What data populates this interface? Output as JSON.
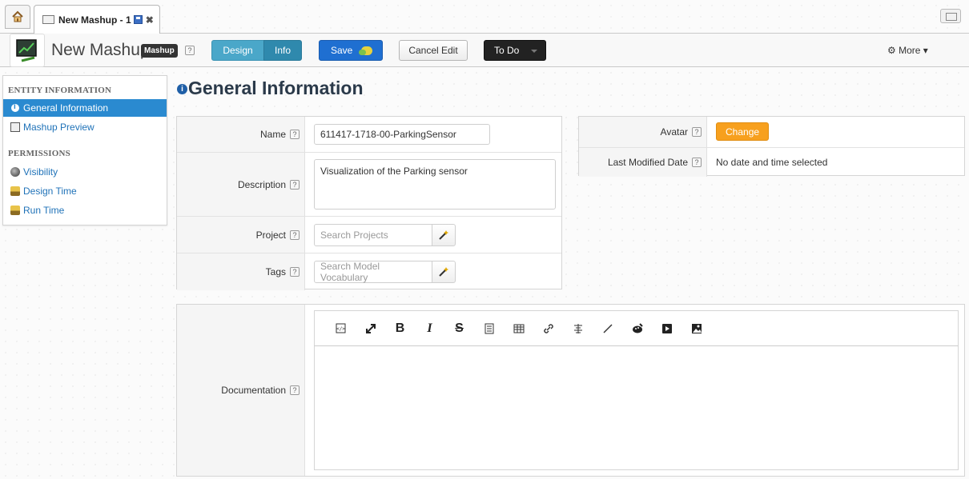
{
  "tabs": {
    "home_icon": "home-icon",
    "active_tab_label": "New Mashup - 1"
  },
  "toolbar": {
    "entity_name": "New Mashup",
    "entity_type_badge": "Mashup",
    "help_glyph": "?",
    "design_label": "Design",
    "info_label": "Info",
    "save_label": "Save",
    "cancel_label": "Cancel Edit",
    "todo_label": "To Do",
    "more_label": "More"
  },
  "sidebar": {
    "section1_title": "ENTITY INFORMATION",
    "items1": [
      {
        "label": "General Information",
        "active": true
      },
      {
        "label": "Mashup Preview",
        "active": false
      }
    ],
    "section2_title": "PERMISSIONS",
    "items2": [
      {
        "label": "Visibility"
      },
      {
        "label": "Design Time"
      },
      {
        "label": "Run Time"
      }
    ]
  },
  "main": {
    "title": "General Information",
    "fields": {
      "name_label": "Name",
      "name_value": "611417-1718-00-ParkingSensor",
      "description_label": "Description",
      "description_value": "Visualization of the Parking sensor",
      "project_label": "Project",
      "project_placeholder": "Search Projects",
      "tags_label": "Tags",
      "tags_placeholder": "Search Model Vocabulary",
      "avatar_label": "Avatar",
      "change_label": "Change",
      "modified_label": "Last Modified Date",
      "modified_value": "No date and time selected",
      "documentation_label": "Documentation"
    },
    "doc_tools": [
      "source-icon",
      "fullscreen-icon",
      "bold-icon",
      "italic-icon",
      "strikethrough-icon",
      "list-icon",
      "table-icon",
      "link-icon",
      "align-icon",
      "line-icon",
      "color-icon",
      "video-icon",
      "image-icon"
    ]
  },
  "colors": {
    "accent": "#2a8ad0",
    "save_button": "#1f6fd1",
    "change_button": "#f7a01e"
  }
}
